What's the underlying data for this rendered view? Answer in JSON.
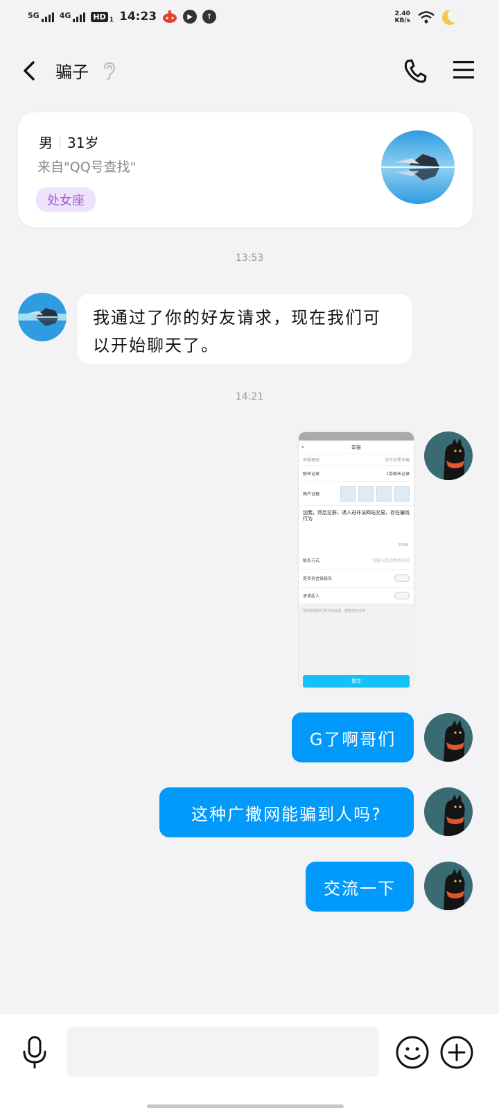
{
  "status_bar": {
    "net1": "5G",
    "net2": "4G",
    "hd": "HD",
    "sim": "1",
    "time": "14:23",
    "speed_value": "2.40",
    "speed_unit": "KB/s"
  },
  "header": {
    "title": "骗子"
  },
  "profile": {
    "gender": "男",
    "age": "31岁",
    "source": "来自\"QQ号查找\"",
    "tag": "处女座"
  },
  "messages": {
    "time1": "13:53",
    "incoming_text": "我通过了你的好友请求，现在我们可以开始聊天了。",
    "time2": "14:21",
    "out1": "G了啊哥们",
    "out2": "这种广撒网能骗到人吗?",
    "out3": "交流一下"
  },
  "image_message": {
    "title": "举报",
    "row1_left": "举报理由",
    "row1_right": "涉诈涉黑诈骗",
    "row2_left": "聊天记录",
    "row2_right": "1条聊天记录",
    "row3_left": "图片证据",
    "report_text": "加我，然后拉群，诱人进非法网站交易，存在骗钱行为",
    "count": "30/80",
    "row4_left": "联系方式",
    "row4_placeholder": "可输入您的手机号码",
    "row5_left": "是否有金钱损失",
    "row6_left": "承诺此人",
    "note": "您的举报我们将尽快处理，感谢您的支持",
    "submit": "提交"
  },
  "colors": {
    "accent": "#0199fa",
    "tag_bg": "#efe3fb",
    "tag_text": "#a25cd6"
  },
  "icons": [
    "back-icon",
    "ear-icon",
    "phone-icon",
    "menu-icon",
    "mic-icon",
    "emoji-icon",
    "plus-icon"
  ]
}
